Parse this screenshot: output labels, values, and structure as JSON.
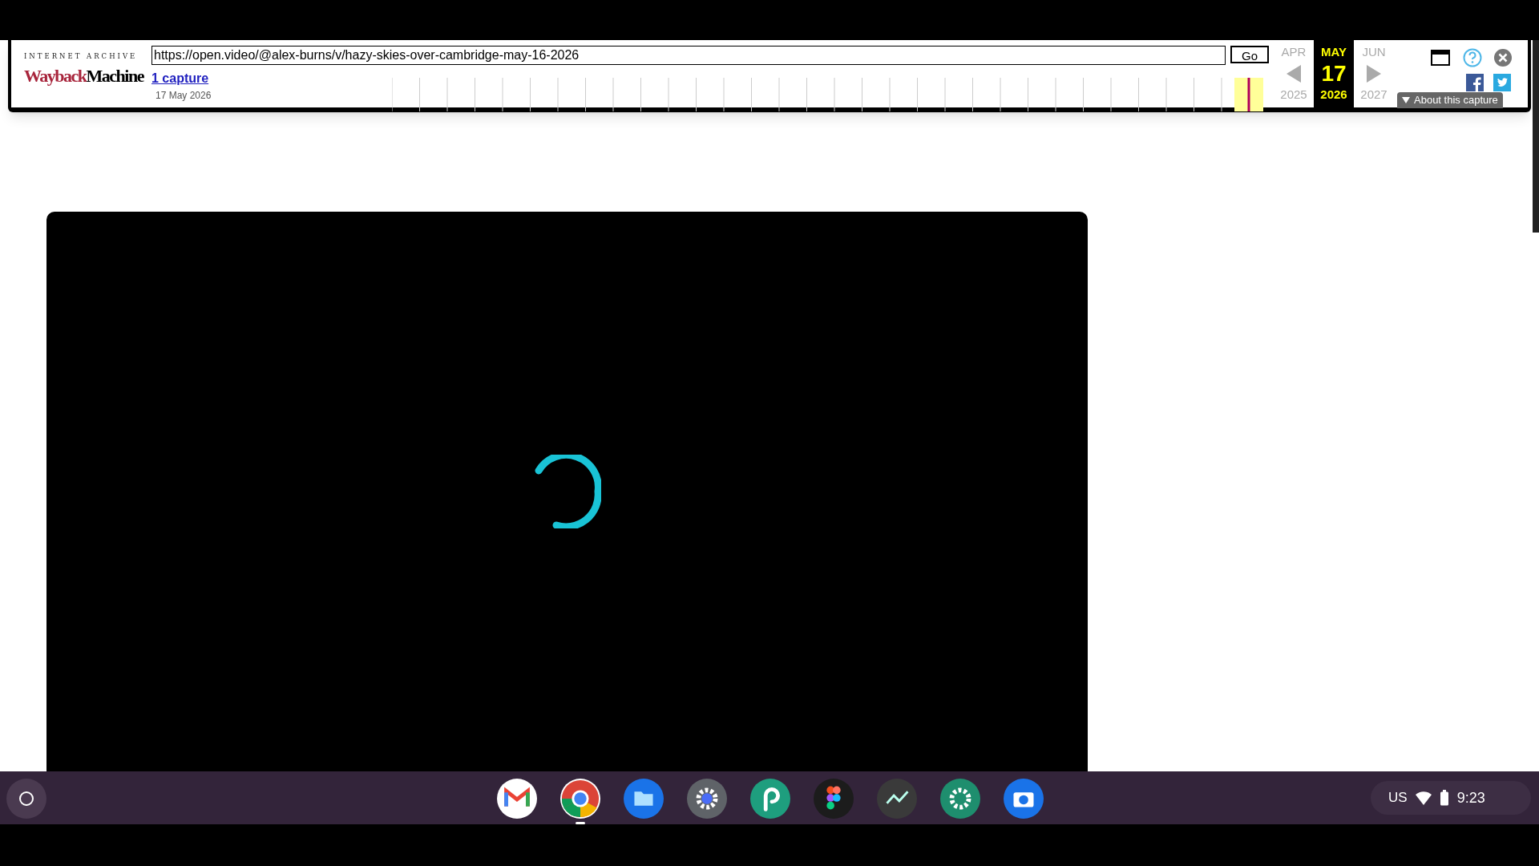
{
  "wayback": {
    "brand_caption": "INTERNET ARCHIVE",
    "logo_part_1": "Wayback",
    "logo_part_2": "Machine",
    "url_value": "https://open.video/@alex-burns/v/hazy-skies-over-cambridge-may-16-2026",
    "go_label": "Go",
    "captures_link": "1 capture",
    "capture_date": "17 May 2026",
    "months": [
      {
        "label": "APR",
        "selected": false
      },
      {
        "label": "MAY",
        "selected": true
      },
      {
        "label": "JUN",
        "selected": false
      }
    ],
    "day": "17",
    "years": [
      {
        "label": "2025",
        "selected": false
      },
      {
        "label": "2026",
        "selected": true
      },
      {
        "label": "2027",
        "selected": false
      }
    ],
    "about_label": "About this capture"
  },
  "taskbar": {
    "apps": [
      {
        "kind": "gmail",
        "running": false
      },
      {
        "kind": "chrome",
        "running": true
      },
      {
        "kind": "files",
        "running": false
      },
      {
        "kind": "settings",
        "running": false
      },
      {
        "kind": "picsart",
        "running": false
      },
      {
        "kind": "figma",
        "running": false
      },
      {
        "kind": "chart",
        "running": false
      },
      {
        "kind": "gear",
        "running": false
      },
      {
        "kind": "camera",
        "running": false
      }
    ],
    "keyboard_layout": "US",
    "time": "9:23"
  }
}
